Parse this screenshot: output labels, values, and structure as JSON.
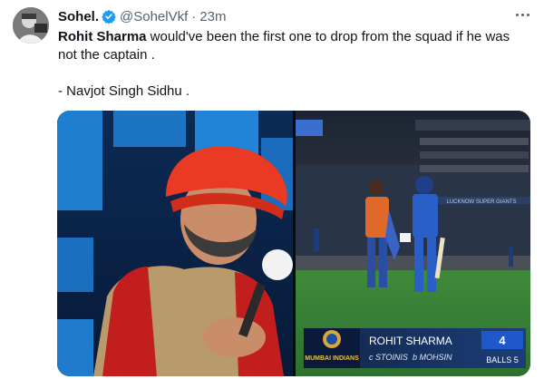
{
  "tweet": {
    "author_name": "Sohel.",
    "handle": "@SohelVkf",
    "separator": "·",
    "timestamp": "23m",
    "line1_bold": "Rohit Sharma",
    "line1_rest": " would've been the first one to drop from the squad if he was",
    "line2": "not the captain .",
    "attribution": "- Navjot Singh Sidhu ."
  },
  "media": {
    "scorecard": {
      "team_logo_text": "MUMBAI INDIANS",
      "batter_name": "ROHIT SHARMA",
      "dismissal_caught": "c STOINIS",
      "dismissal_bowled": "b MOHSIN",
      "runs": "4",
      "balls_label": "BALLS 5"
    },
    "stadium_board": "LUCKNOW SUPER GIANTS"
  },
  "colors": {
    "verified": "#1d9bf0",
    "text": "#0f1419",
    "muted": "#536471"
  }
}
